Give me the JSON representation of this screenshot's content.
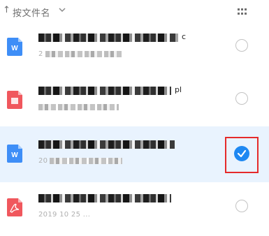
{
  "sort_bar": {
    "arrow": "↑",
    "label": "按文件名",
    "sort_chevron_icon": "chevron-down-icon",
    "view_toggle_icon": "grid-view-icon"
  },
  "files": [
    {
      "type": "word",
      "icon": "word-doc-icon",
      "color": "#3e8ef7",
      "name_tail": "c",
      "meta": "2",
      "state": "unselected"
    },
    {
      "type": "wps",
      "icon": "wps-presentation-icon",
      "color": "#f0575d",
      "name_tail": "pl",
      "meta": "",
      "state": "unselected"
    },
    {
      "type": "word",
      "icon": "word-doc-icon",
      "color": "#3e8ef7",
      "name_tail": "",
      "meta": "20",
      "state": "selected"
    },
    {
      "type": "pdf",
      "icon": "pdf-icon",
      "color": "#f0575d",
      "name_tail": "",
      "meta": "2019 10 25 ...",
      "state": "unselected"
    }
  ],
  "selection_highlight_color": "#e52a2a",
  "accent": "#1e88f2"
}
